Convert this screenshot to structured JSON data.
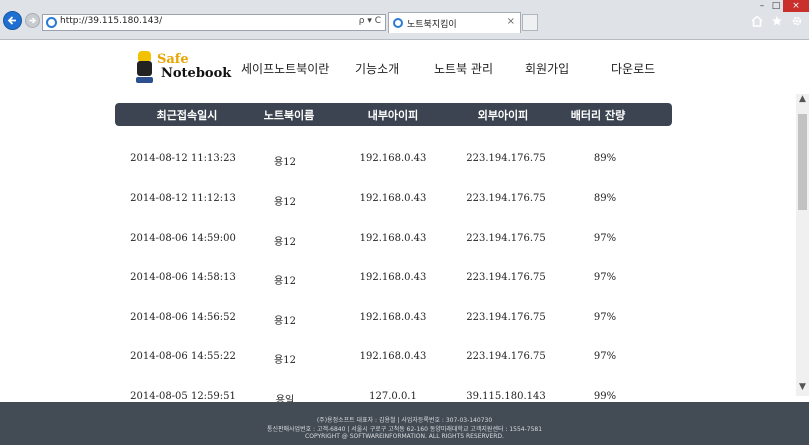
{
  "browser": {
    "url": "http://39.115.180.143/",
    "address_tools": "ρ ▾ C",
    "tab_title": "노트북지킴이",
    "tab_close": "×",
    "window_controls": {
      "minimize": "–",
      "restore": "□",
      "close": "×"
    }
  },
  "site": {
    "logo": {
      "line1": "Safe",
      "line2": "Notebook"
    },
    "menu": [
      "세이프노트북이란",
      "기능소개",
      "노트북 관리",
      "회원가입",
      "다운로드"
    ]
  },
  "table": {
    "headers": [
      "최근접속일시",
      "노트북이름",
      "내부아이피",
      "외부아이피",
      "배터리 잔량"
    ],
    "rows": [
      [
        "2014-08-12 11:13:23",
        "용12",
        "192.168.0.43",
        "223.194.176.75",
        "89%"
      ],
      [
        "2014-08-12 11:12:13",
        "용12",
        "192.168.0.43",
        "223.194.176.75",
        "89%"
      ],
      [
        "2014-08-06 14:59:00",
        "용12",
        "192.168.0.43",
        "223.194.176.75",
        "97%"
      ],
      [
        "2014-08-06 14:58:13",
        "용12",
        "192.168.0.43",
        "223.194.176.75",
        "97%"
      ],
      [
        "2014-08-06 14:56:52",
        "용12",
        "192.168.0.43",
        "223.194.176.75",
        "97%"
      ],
      [
        "2014-08-06 14:55:22",
        "용12",
        "192.168.0.43",
        "223.194.176.75",
        "97%"
      ],
      [
        "2014-08-05 12:59:51",
        "용일",
        "127.0.0.1",
        "39.115.180.143",
        "99%"
      ]
    ]
  },
  "footer": {
    "lines": [
      "(주)용정소프트 대표자 : 김용철 | 사업자등록번호 : 307-03-140730",
      "통신판매사업번호 : 고객-6840 | 서울시 구로구 고척동 62-160 동양미래대학교 고객지원센터 : 1554-7581",
      "COPYRIGHT @ SOFTWAREINFORMATION. ALL RIGHTS RESERVERD."
    ]
  },
  "colors": {
    "header_bar": "#3b4450",
    "footer_bg": "#434b54",
    "logo_accent": "#e8a400",
    "browser_back": "#1e6fd0"
  },
  "icons": {
    "back": "arrow-left-icon",
    "forward": "arrow-right-icon",
    "home": "home-icon",
    "favorites": "star-icon",
    "settings": "gear-icon"
  }
}
